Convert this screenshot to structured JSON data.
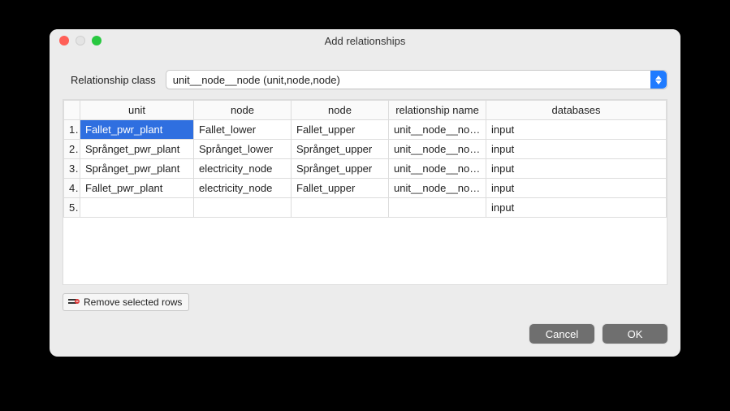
{
  "window": {
    "title": "Add relationships"
  },
  "form": {
    "class_label": "Relationship class",
    "class_value": "unit__node__node (unit,node,node)"
  },
  "table": {
    "headers": [
      "unit",
      "node",
      "node",
      "relationship name",
      "databases"
    ],
    "rows": [
      {
        "n": "1",
        "unit": "Fallet_pwr_plant",
        "node1": "Fallet_lower",
        "node2": "Fallet_upper",
        "rel": "unit__node__nod…",
        "db": "input",
        "selected_col": 0
      },
      {
        "n": "2",
        "unit": "Språnget_pwr_plant",
        "node1": "Språnget_lower",
        "node2": "Språnget_upper",
        "rel": "unit__node__nod…",
        "db": "input"
      },
      {
        "n": "3",
        "unit": "Språnget_pwr_plant",
        "node1": "electricity_node",
        "node2": "Språnget_upper",
        "rel": "unit__node__nod…",
        "db": "input"
      },
      {
        "n": "4",
        "unit": "Fallet_pwr_plant",
        "node1": "electricity_node",
        "node2": "Fallet_upper",
        "rel": "unit__node__nod…",
        "db": "input"
      },
      {
        "n": "5",
        "unit": "",
        "node1": "",
        "node2": "",
        "rel": "",
        "db": "input"
      }
    ]
  },
  "buttons": {
    "remove_rows": "Remove selected rows",
    "cancel": "Cancel",
    "ok": "OK"
  }
}
